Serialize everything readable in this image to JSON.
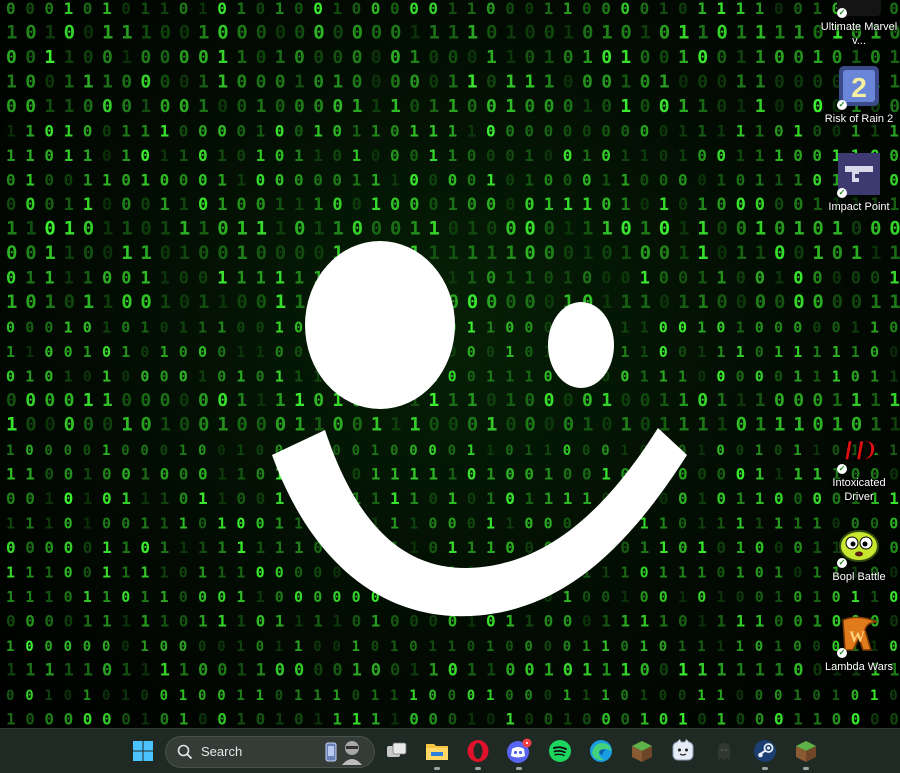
{
  "desktop": {
    "wallpaper_digits": "01",
    "icons": [
      {
        "name": "ultimate-marvel-vs-capcom-3",
        "label": "Ultimate Marvel v...",
        "icon": "ultimate-marvel-icon",
        "color": "#141414"
      },
      {
        "name": "risk-of-rain-2",
        "label": "Risk of Rain 2",
        "icon": "risk-of-rain-2-icon",
        "color": "#3b4b8a"
      },
      {
        "name": "impact-point",
        "label": "Impact Point",
        "icon": "pistol-icon",
        "color": "#3c3a70"
      },
      {
        "name": "intoxicated-driver",
        "label": "Intoxicated Driver",
        "icon": "id-logo-icon",
        "color": "#e01010"
      },
      {
        "name": "bopl-battle",
        "label": "Bopl Battle",
        "icon": "bopl-blob-icon",
        "color": "#c8e830"
      },
      {
        "name": "lambda-wars",
        "label": "Lambda Wars",
        "icon": "lambda-wars-icon",
        "color": "#e07a1a"
      }
    ]
  },
  "taskbar": {
    "search_label": "Search",
    "items": [
      {
        "name": "start-button",
        "icon": "windows-logo-icon"
      },
      {
        "name": "task-view-button",
        "icon": "task-view-icon"
      },
      {
        "name": "file-explorer",
        "icon": "folder-icon"
      },
      {
        "name": "opera-browser",
        "icon": "opera-icon"
      },
      {
        "name": "discord",
        "icon": "discord-icon"
      },
      {
        "name": "spotify",
        "icon": "spotify-icon"
      },
      {
        "name": "microsoft-edge",
        "icon": "edge-icon"
      },
      {
        "name": "minecraft",
        "icon": "grass-block-icon"
      },
      {
        "name": "companion-app",
        "icon": "cute-face-icon"
      },
      {
        "name": "stealth-app",
        "icon": "ghost-icon"
      },
      {
        "name": "steam",
        "icon": "steam-icon"
      },
      {
        "name": "minecraft-launcher",
        "icon": "grass-block-icon"
      }
    ]
  },
  "colors": {
    "matrix_green": "#2fd12f",
    "smiley": "#ffffff",
    "taskbar_bg": "#1f2a24"
  }
}
